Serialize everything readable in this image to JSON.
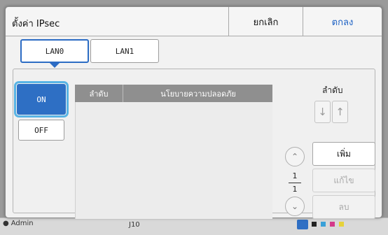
{
  "dialog": {
    "title": "ตั้งค่า IPsec",
    "cancel_label": "ยกเลิก",
    "ok_label": "ตกลง"
  },
  "lan_tabs": [
    {
      "label": "LAN0",
      "selected": true
    },
    {
      "label": "LAN1",
      "selected": false
    }
  ],
  "toggle": {
    "on_label": "ON",
    "off_label": "OFF",
    "selected": "ON"
  },
  "table": {
    "col_order": "ลำดับ",
    "col_policy": "นโยบายความปลอดภัย",
    "rows": []
  },
  "order_controls": {
    "label": "ลำดับ",
    "down_icon": "arrow-down-icon",
    "up_icon": "arrow-up-icon"
  },
  "pager": {
    "current": "1",
    "total": "1"
  },
  "actions": {
    "add_label": "เพิ่ม",
    "edit_label": "แก้ไข",
    "delete_label": "ลบ"
  },
  "background": {
    "user_label": "Admin",
    "code_label": "J10"
  },
  "colors": {
    "accent": "#2e6fc4",
    "ok_text": "#1e62c4",
    "focus_ring": "#59b4e4",
    "table_header": "#8f8f8f"
  }
}
